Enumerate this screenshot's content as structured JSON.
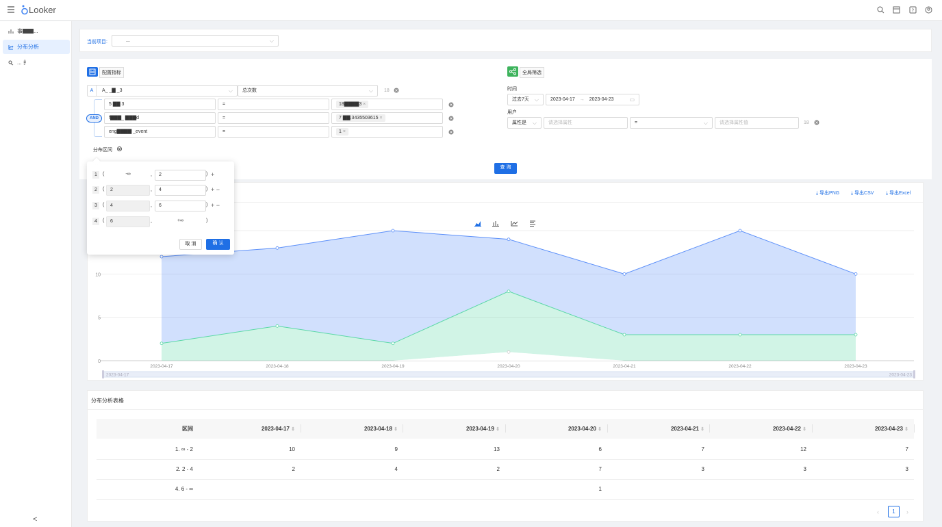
{
  "app": {
    "name": "Looker"
  },
  "sidebar": {
    "items": [
      {
        "label": "事▇▇...",
        "icon": "bar-chart-icon"
      },
      {
        "label": "分布分析",
        "icon": "line-chart-icon",
        "active": true
      },
      {
        "label": "... 扌",
        "icon": "user-flow-icon"
      }
    ],
    "collapse": "<"
  },
  "project": {
    "label": "当前项目:",
    "value": "..."
  },
  "metrics": {
    "title": "配置指标",
    "event_badge": "A",
    "event_name": "A_ _▇ _3",
    "aggregate": "总次数",
    "count": "18",
    "and_label": "AND",
    "filters": [
      {
        "prop": "5 ▇▇ 3",
        "op": "=",
        "value": "18▇▇▇▇3",
        "tag": true
      },
      {
        "prop": "f▇▇▇_ ▇▇▇d",
        "op": "=",
        "value": "7 ▇▇.3435503615",
        "tag": true
      },
      {
        "prop": "eng▇▇▇▇ _event",
        "op": "=",
        "value": "1",
        "tag": true
      }
    ]
  },
  "global_filter": {
    "title": "全局筛选",
    "time_label": "时间",
    "time_range": "过去7天",
    "start": "2023-04-17",
    "end": "2023-04-23",
    "user_label": "用户",
    "user_type": "属性是",
    "attr_placeholder": "请选择属性",
    "op": "=",
    "value_placeholder": "请选择属性值",
    "count": "18"
  },
  "distribution": {
    "label": "分布区间",
    "rows": [
      {
        "idx": "1",
        "from": "-∞",
        "to": "2",
        "actions": "+"
      },
      {
        "idx": "2",
        "from": "2",
        "to": "4",
        "actions": "+ −"
      },
      {
        "idx": "3",
        "from": "4",
        "to": "6",
        "actions": "+ −"
      },
      {
        "idx": "4",
        "from": "6",
        "to": "+∞",
        "actions": ""
      }
    ],
    "open_paren": "(",
    "comma": ",",
    "close_paren": ")",
    "cancel": "取 消",
    "confirm": "确 认"
  },
  "query_button": "查 询",
  "exports": {
    "png": "导出PNG",
    "csv": "导出CSV",
    "excel": "导出Excel"
  },
  "chart_data": {
    "type": "area",
    "x": [
      "2023-04-17",
      "2023-04-18",
      "2023-04-19",
      "2023-04-20",
      "2023-04-21",
      "2023-04-22",
      "2023-04-23"
    ],
    "series": [
      {
        "values": [
          10,
          9,
          13,
          6,
          7,
          12,
          7
        ],
        "color": "#5b8ff9"
      },
      {
        "values": [
          2,
          4,
          2,
          7,
          3,
          3,
          3
        ],
        "color": "#5ad8a6"
      },
      {
        "values": [
          0,
          0,
          0,
          1,
          0,
          0,
          0
        ],
        "color": "#cccccc"
      }
    ],
    "stacked": true,
    "yticks": [
      "0",
      "5",
      "10"
    ],
    "ylim": [
      0,
      15
    ],
    "slider": {
      "start": "2023-04-17",
      "end": "2023-04-23"
    },
    "chart_type_icons": [
      "area-chart-icon",
      "bar-chart-icon",
      "line-chart-icon",
      "table-list-icon"
    ]
  },
  "table": {
    "title": "分布分析表格",
    "headers": [
      "区间",
      "2023-04-17",
      "2023-04-18",
      "2023-04-19",
      "2023-04-20",
      "2023-04-21",
      "2023-04-22",
      "2023-04-23"
    ],
    "rows": [
      [
        "1. ∞ - 2",
        "10",
        "9",
        "13",
        "6",
        "7",
        "12",
        "7"
      ],
      [
        "2. 2 - 4",
        "2",
        "4",
        "2",
        "7",
        "3",
        "3",
        "3"
      ],
      [
        "4. 6 - ∞",
        "",
        "",
        "",
        "1",
        "",
        "",
        ""
      ]
    ],
    "page": "1"
  },
  "colors": {
    "accent": "#1f6fe5",
    "area_blue": "#5b8ff9",
    "area_green": "#5ad8a6",
    "filter_green": "#3db35c"
  }
}
